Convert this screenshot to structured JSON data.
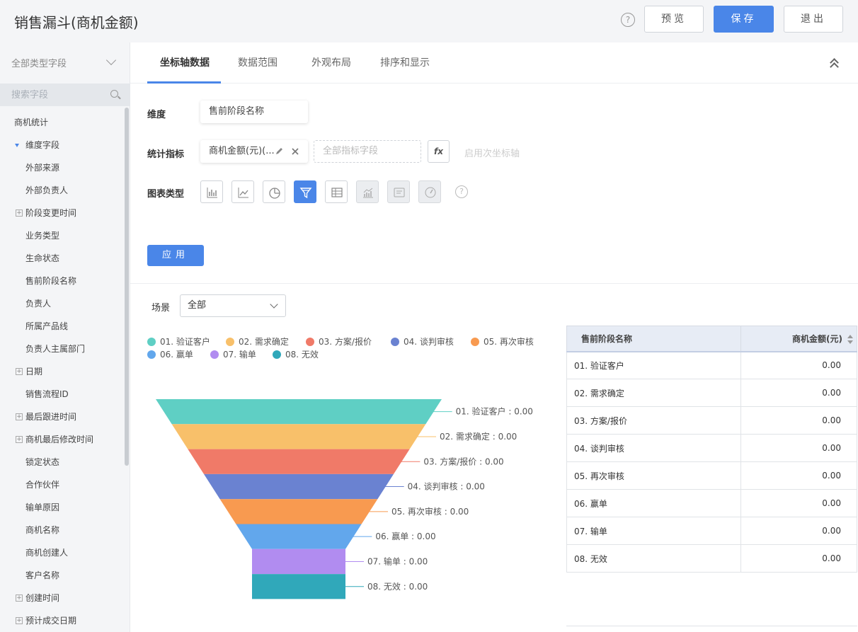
{
  "header": {
    "title": "销售漏斗(商机金额)",
    "help_glyph": "?",
    "preview_label": "预览",
    "save_label": "保存",
    "exit_label": "退出"
  },
  "sidebar": {
    "field_type": "全部类型字段",
    "search_placeholder": "搜索字段",
    "items": [
      {
        "label": "商机统计",
        "kind": "group"
      },
      {
        "label": "维度字段",
        "kind": "open"
      },
      {
        "label": "外部来源",
        "kind": "leaf"
      },
      {
        "label": "外部负责人",
        "kind": "leaf"
      },
      {
        "label": "阶段变更时间",
        "kind": "expand"
      },
      {
        "label": "业务类型",
        "kind": "leaf"
      },
      {
        "label": "生命状态",
        "kind": "leaf"
      },
      {
        "label": "售前阶段名称",
        "kind": "leaf"
      },
      {
        "label": "负责人",
        "kind": "leaf"
      },
      {
        "label": "所属产品线",
        "kind": "leaf"
      },
      {
        "label": "负责人主属部门",
        "kind": "leaf"
      },
      {
        "label": "日期",
        "kind": "expand"
      },
      {
        "label": "销售流程ID",
        "kind": "leaf"
      },
      {
        "label": "最后跟进时间",
        "kind": "expand"
      },
      {
        "label": "商机最后修改时间",
        "kind": "expand"
      },
      {
        "label": "锁定状态",
        "kind": "leaf"
      },
      {
        "label": "合作伙伴",
        "kind": "leaf"
      },
      {
        "label": "输单原因",
        "kind": "leaf"
      },
      {
        "label": "商机名称",
        "kind": "leaf"
      },
      {
        "label": "商机创建人",
        "kind": "leaf"
      },
      {
        "label": "客户名称",
        "kind": "leaf"
      },
      {
        "label": "创建时间",
        "kind": "expand"
      },
      {
        "label": "预计成交日期",
        "kind": "expand"
      }
    ]
  },
  "tabs": [
    "坐标轴数据",
    "数据范围",
    "外观布局",
    "排序和显示"
  ],
  "form": {
    "dimension_label": "维度",
    "dimension_value": "售前阶段名称",
    "metric_label": "统计指标",
    "metric_value": "商机金额(元)(...",
    "metric_placeholder": "全部指标字段",
    "fx_label": "fx",
    "secondary_axis": "启用次坐标轴",
    "chart_type_label": "图表类型",
    "chart_types": [
      "bar-chart-icon",
      "line-chart-icon",
      "pie-chart-icon",
      "funnel-chart-icon",
      "table-chart-icon",
      "combo-chart-icon",
      "text-card-icon",
      "gauge-chart-icon"
    ],
    "apply_label": "应用"
  },
  "scene": {
    "label": "场景",
    "value": "全部"
  },
  "colors": {
    "accent": "#4a86e8",
    "stages": [
      "#5fcfc4",
      "#f8c06a",
      "#f07a68",
      "#6a82d1",
      "#f89a50",
      "#62a7ec",
      "#b18cf0",
      "#30a8ba"
    ]
  },
  "chart_data": {
    "type": "funnel",
    "categories": [
      "01. 验证客户",
      "02. 需求确定",
      "03. 方案/报价",
      "04. 谈判审核",
      "05. 再次审核",
      "06. 赢单",
      "07. 输单",
      "08. 无效"
    ],
    "values": [
      0,
      0,
      0,
      0,
      0,
      0,
      0,
      0
    ],
    "value_labels": [
      "0.00",
      "0.00",
      "0.00",
      "0.00",
      "0.00",
      "0.00",
      "0.00",
      "0.00"
    ],
    "legend_position": "top-left"
  },
  "table": {
    "headers": [
      "售前阶段名称",
      "商机金额(元)"
    ],
    "rows": [
      [
        "01. 验证客户",
        "0.00"
      ],
      [
        "02. 需求确定",
        "0.00"
      ],
      [
        "03. 方案/报价",
        "0.00"
      ],
      [
        "04. 谈判审核",
        "0.00"
      ],
      [
        "05. 再次审核",
        "0.00"
      ],
      [
        "06. 赢单",
        "0.00"
      ],
      [
        "07. 输单",
        "0.00"
      ],
      [
        "08. 无效",
        "0.00"
      ]
    ]
  }
}
